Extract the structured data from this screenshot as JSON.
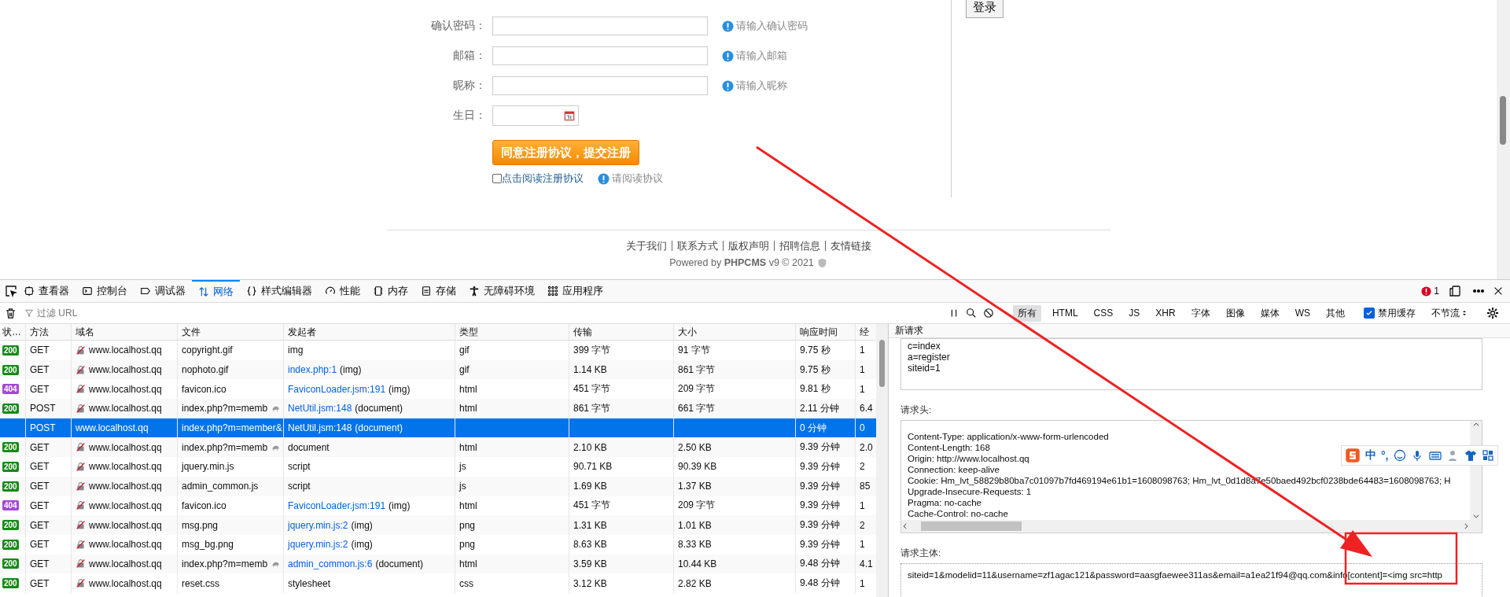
{
  "page": {
    "form_fields": [
      {
        "label": "确认密码：",
        "hint": "请输入确认密码",
        "kind": "text"
      },
      {
        "label": "邮箱：",
        "hint": "请输入邮箱",
        "kind": "text"
      },
      {
        "label": "昵称：",
        "hint": "请输入昵称",
        "kind": "text"
      },
      {
        "label": "生日：",
        "kind": "date"
      }
    ],
    "submit_button": "同意注册协议，提交注册",
    "agreement": {
      "label": "点击阅读注册协议",
      "checked": false,
      "hint": "请阅读协议"
    },
    "login_button": "登录",
    "footer_links": [
      "关于我们",
      "联系方式",
      "版权声明",
      "招聘信息",
      "友情链接"
    ],
    "powered": "Powered by **PHPCMS** v9 © 2021"
  },
  "devtools": {
    "tabs": [
      {
        "label": "查看器",
        "selected": false
      },
      {
        "label": "控制台",
        "selected": false
      },
      {
        "label": "调试器",
        "selected": false
      },
      {
        "label": "网络",
        "selected": true
      },
      {
        "label": "样式编辑器",
        "selected": false
      },
      {
        "label": "性能",
        "selected": false
      },
      {
        "label": "内存",
        "selected": false
      },
      {
        "label": "存储",
        "selected": false
      },
      {
        "label": "无障碍环境",
        "selected": false
      },
      {
        "label": "应用程序",
        "selected": false
      }
    ],
    "error_count": "1",
    "filter_placeholder": "过滤 URL",
    "type_filters": [
      {
        "label": "所有",
        "selected": true
      },
      {
        "label": "HTML",
        "selected": false
      },
      {
        "label": "CSS",
        "selected": false
      },
      {
        "label": "JS",
        "selected": false
      },
      {
        "label": "XHR",
        "selected": false
      },
      {
        "label": "字体",
        "selected": false
      },
      {
        "label": "图像",
        "selected": false
      },
      {
        "label": "媒体",
        "selected": false
      },
      {
        "label": "WS",
        "selected": false
      },
      {
        "label": "其他",
        "selected": false
      }
    ],
    "disable_cache": {
      "label": "禁用缓存",
      "checked": true
    },
    "throttle": "不节流",
    "columns": [
      "状…",
      "方法",
      "域名",
      "文件",
      "发起者",
      "类型",
      "传输",
      "大小",
      "响应时间",
      "经"
    ],
    "rows": [
      {
        "selected": false,
        "status": "200",
        "color": "#178a17",
        "method": "GET",
        "domain": "www.localhost.qq",
        "insecure": true,
        "file": "copyright.gif",
        "slow": false,
        "initiator": "img",
        "type": "gif",
        "transferred": "399 字节",
        "size": "91 字节",
        "time": "9.75 秒",
        "column_10": "1"
      },
      {
        "selected": false,
        "status": "200",
        "color": "#178a17",
        "method": "GET",
        "domain": "www.localhost.qq",
        "insecure": true,
        "file": "nophoto.gif",
        "slow": false,
        "initiator_link": "index.php:1",
        "initiator": "(img)",
        "type": "gif",
        "transferred": "1.14 KB",
        "size": "861 字节",
        "time": "9.75 秒",
        "column_10": "1"
      },
      {
        "selected": false,
        "status": "404",
        "color": "#a347d4",
        "method": "GET",
        "domain": "www.localhost.qq",
        "insecure": true,
        "file": "favicon.ico",
        "slow": false,
        "initiator_link": "FaviconLoader.jsm:191",
        "initiator": "(img)",
        "type": "html",
        "transferred": "451 字节",
        "size": "209 字节",
        "time": "9.81 秒",
        "column_10": "1"
      },
      {
        "selected": false,
        "status": "200",
        "color": "#178a17",
        "method": "POST",
        "domain": "www.localhost.qq",
        "insecure": true,
        "file": "index.php?m=memb",
        "slow": true,
        "initiator_link": "NetUtil.jsm:148",
        "initiator": "(document)",
        "type": "html",
        "transferred": "861 字节",
        "size": "661 字节",
        "time": "2.11 分钟",
        "column_10": "6.4"
      },
      {
        "selected": true,
        "method": "POST",
        "domain": "www.localhost.qq",
        "insecure": false,
        "file": "index.php?m=member&",
        "slow": false,
        "initiator_link": "NetUtil.jsm:148",
        "initiator": "(document)",
        "time": "0 分钟",
        "column_10": "0"
      },
      {
        "selected": false,
        "status": "200",
        "color": "#178a17",
        "method": "GET",
        "domain": "www.localhost.qq",
        "insecure": true,
        "file": "index.php?m=memb",
        "slow": true,
        "initiator": "document",
        "type": "html",
        "transferred": "2.10 KB",
        "size": "2.50 KB",
        "time": "9.39 分钟",
        "column_10": "2.0"
      },
      {
        "selected": false,
        "status": "200",
        "color": "#178a17",
        "method": "GET",
        "domain": "www.localhost.qq",
        "insecure": true,
        "file": "jquery.min.js",
        "slow": false,
        "initiator": "script",
        "type": "js",
        "transferred": "90.71 KB",
        "size": "90.39 KB",
        "time": "9.39 分钟",
        "column_10": "2"
      },
      {
        "selected": false,
        "status": "200",
        "color": "#178a17",
        "method": "GET",
        "domain": "www.localhost.qq",
        "insecure": true,
        "file": "admin_common.js",
        "slow": false,
        "initiator": "script",
        "type": "js",
        "transferred": "1.69 KB",
        "size": "1.37 KB",
        "time": "9.39 分钟",
        "column_10": "85"
      },
      {
        "selected": false,
        "status": "404",
        "color": "#a347d4",
        "method": "GET",
        "domain": "www.localhost.qq",
        "insecure": true,
        "file": "favicon.ico",
        "slow": false,
        "initiator_link": "FaviconLoader.jsm:191",
        "initiator": "(img)",
        "type": "html",
        "transferred": "451 字节",
        "size": "209 字节",
        "time": "9.39 分钟",
        "column_10": "1"
      },
      {
        "selected": false,
        "status": "200",
        "color": "#178a17",
        "method": "GET",
        "domain": "www.localhost.qq",
        "insecure": true,
        "file": "msg.png",
        "slow": false,
        "initiator_link": "jquery.min.js:2",
        "initiator": "(img)",
        "type": "png",
        "transferred": "1.31 KB",
        "size": "1.01 KB",
        "time": "9.39 分钟",
        "column_10": "2"
      },
      {
        "selected": false,
        "status": "200",
        "color": "#178a17",
        "method": "GET",
        "domain": "www.localhost.qq",
        "insecure": true,
        "file": "msg_bg.png",
        "slow": false,
        "initiator_link": "jquery.min.js:2",
        "initiator": "(img)",
        "type": "png",
        "transferred": "8.63 KB",
        "size": "8.33 KB",
        "time": "9.39 分钟",
        "column_10": "1"
      },
      {
        "selected": false,
        "status": "200",
        "color": "#178a17",
        "method": "GET",
        "domain": "www.localhost.qq",
        "insecure": true,
        "file": "index.php?m=memb",
        "slow": true,
        "initiator_link": "admin_common.js:6",
        "initiator": "(document)",
        "type": "html",
        "transferred": "3.59 KB",
        "size": "10.44 KB",
        "time": "9.48 分钟",
        "column_10": "4.1"
      },
      {
        "selected": false,
        "status": "200",
        "color": "#178a17",
        "method": "GET",
        "domain": "www.localhost.qq",
        "insecure": true,
        "file": "reset.css",
        "slow": false,
        "initiator": "stylesheet",
        "type": "css",
        "transferred": "3.12 KB",
        "size": "2.82 KB",
        "time": "9.48 分钟",
        "column_10": "1"
      }
    ],
    "details": {
      "title": "新请求",
      "query_lines": [
        "c=index",
        "a=register",
        "siteid=1"
      ],
      "headers_label": "请求头:",
      "header_lines": [
        "Content-Type: application/x-www-form-urlencoded",
        "Content-Length: 168",
        "Origin: http://www.localhost.qq",
        "Connection: keep-alive",
        "Cookie: Hm_lvt_58829b80ba7c01097b7fd469194e61b1=1608098763; Hm_lvt_0d1d8a7e50baed492bcf0238bde64483=1608098763; H",
        "Upgrade-Insecure-Requests: 1",
        "Pragma: no-cache",
        "Cache-Control: no-cache"
      ],
      "body_label": "请求主体:",
      "body": "siteid=1&modelid=11&username=zf1agac121&password=aasgfaewee311as&email=a1ea21f94@qq.com&info[content]=<img src=http"
    }
  },
  "ime_toolbar": {
    "mode": "中",
    "punctuation": "°,"
  }
}
